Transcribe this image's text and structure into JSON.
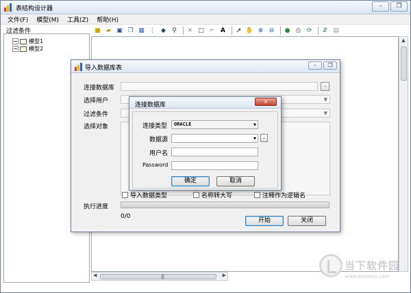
{
  "window": {
    "title": "表结构设计器"
  },
  "menu": [
    "文件(F)",
    "模型(M)",
    "工具(Z)",
    "帮助(H)"
  ],
  "sidebar": {
    "label": "过滤条件",
    "tree": [
      {
        "label": "模型1"
      },
      {
        "label": "模型2"
      }
    ]
  },
  "import_dialog": {
    "title": "导入数据库表",
    "labels": {
      "connect_db": "连接数据库",
      "select_user": "选择用户",
      "filter": "过滤条件",
      "select_objects": "选择对象",
      "progress": "执行进度"
    },
    "browse": "..",
    "checkboxes": [
      "导入数据类型",
      "名称转大写",
      "注释作为逻辑名"
    ],
    "progress_text": "0/0",
    "progress_value": 0,
    "buttons": {
      "start": "开始",
      "close": "关闭"
    }
  },
  "connect_dialog": {
    "title": "连接数据库",
    "close_glyph": "x",
    "fields": {
      "type_label": "连接类型",
      "type_value": "ORACLE",
      "source_label": "数据源",
      "source_browse": "..",
      "username_label": "用户名",
      "password_label": "Password"
    },
    "buttons": {
      "ok": "确定",
      "cancel": "取消"
    }
  },
  "watermark": {
    "text": "当下软件园",
    "url": "www.downxia.com"
  }
}
